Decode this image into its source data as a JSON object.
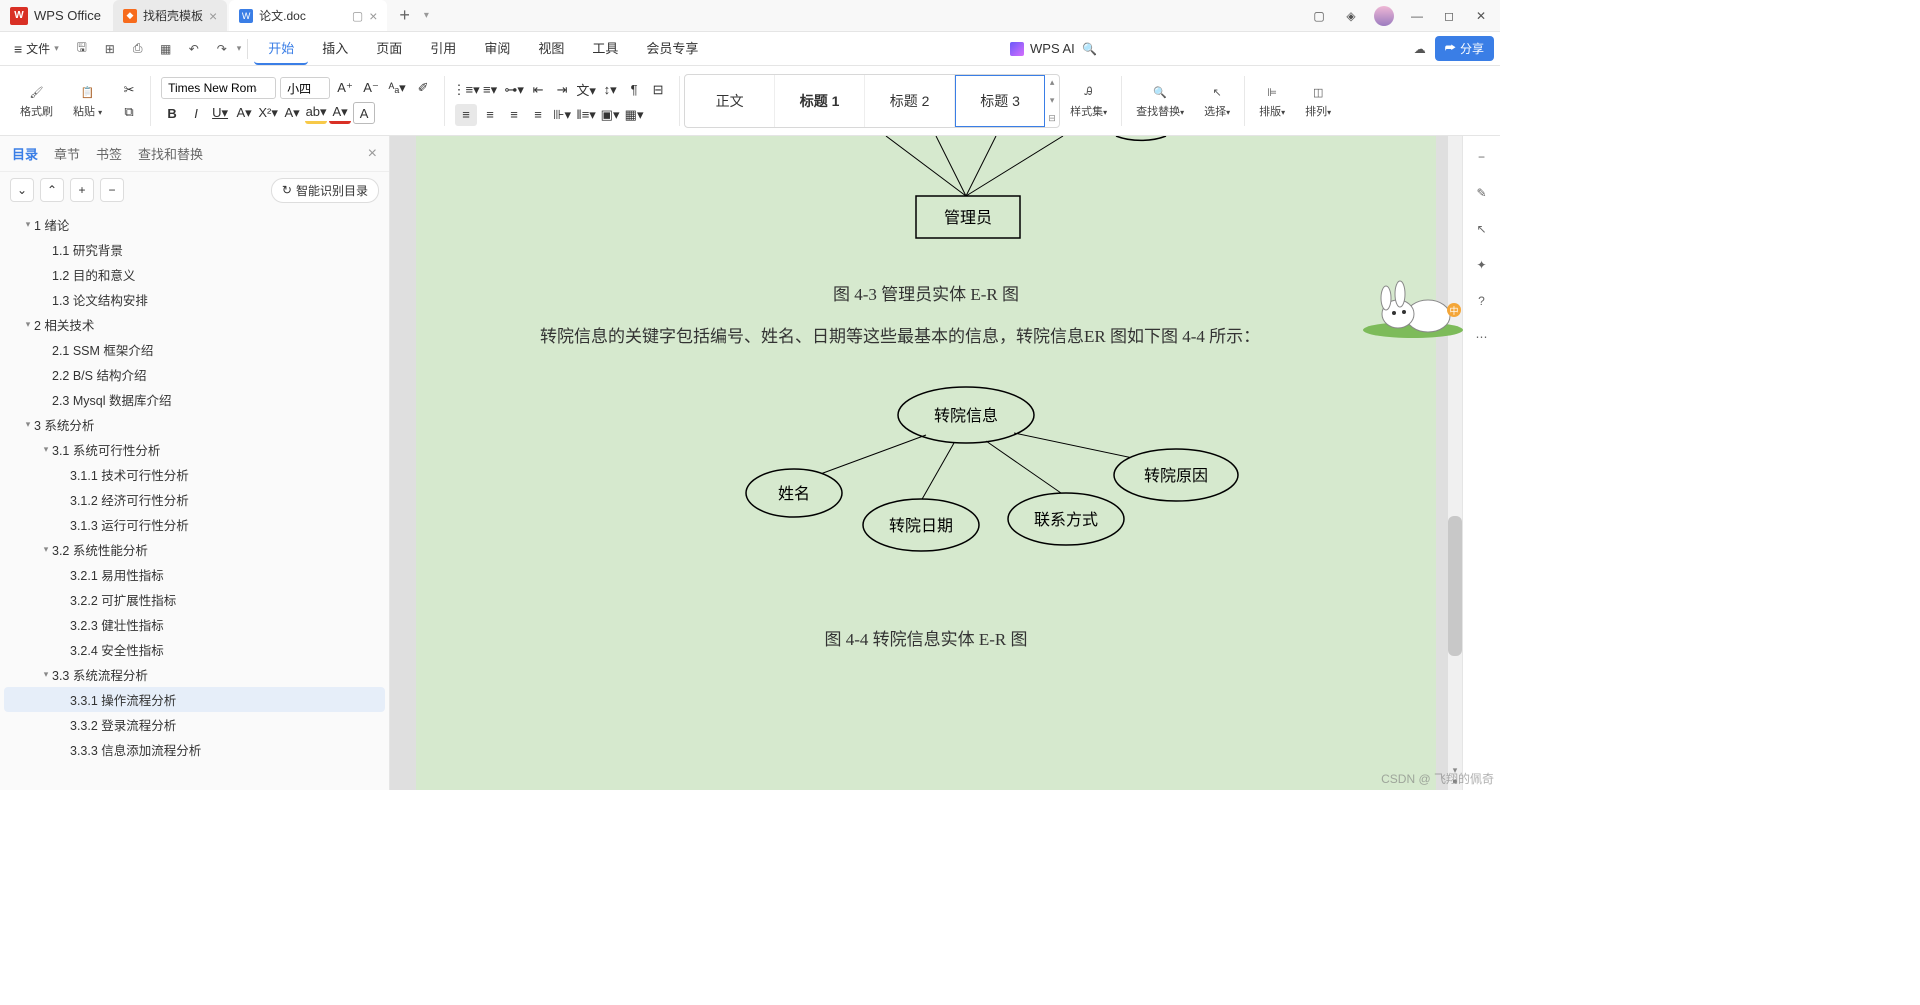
{
  "app": {
    "name": "WPS Office"
  },
  "tabs": [
    {
      "label": "找稻壳模板",
      "icon_color": "orange"
    },
    {
      "label": "论文.doc",
      "icon_color": "blue",
      "active": true
    }
  ],
  "menu": {
    "file": "文件",
    "items": [
      "开始",
      "插入",
      "页面",
      "引用",
      "审阅",
      "视图",
      "工具",
      "会员专享"
    ],
    "active": "开始",
    "ai_label": "WPS AI",
    "share": "分享"
  },
  "ribbon": {
    "format_brush": "格式刷",
    "paste": "粘贴",
    "font_name": "Times New Roman",
    "font_size": "小四",
    "body_text": "正文",
    "heading1": "标题 1",
    "heading2": "标题 2",
    "heading3": "标题 3",
    "styles_set": "样式集",
    "find_replace": "查找替换",
    "select": "选择",
    "arrange": "排版",
    "arrange2": "排列"
  },
  "sidebar": {
    "tabs": [
      "目录",
      "章节",
      "书签",
      "查找和替换"
    ],
    "active": "目录",
    "smart": "智能识别目录",
    "outline": [
      {
        "level": 0,
        "text": "1 绪论",
        "caret": true
      },
      {
        "level": 1,
        "text": "1.1 研究背景"
      },
      {
        "level": 1,
        "text": "1.2 目的和意义"
      },
      {
        "level": 1,
        "text": "1.3 论文结构安排"
      },
      {
        "level": 0,
        "text": "2 相关技术",
        "caret": true
      },
      {
        "level": 1,
        "text": "2.1 SSM 框架介绍"
      },
      {
        "level": 1,
        "text": "2.2 B/S 结构介绍"
      },
      {
        "level": 1,
        "text": "2.3 Mysql 数据库介绍"
      },
      {
        "level": 0,
        "text": "3 系统分析",
        "caret": true
      },
      {
        "level": 1,
        "text": "3.1 系统可行性分析",
        "caret": true
      },
      {
        "level": 2,
        "text": "3.1.1 技术可行性分析"
      },
      {
        "level": 2,
        "text": "3.1.2 经济可行性分析"
      },
      {
        "level": 2,
        "text": "3.1.3 运行可行性分析"
      },
      {
        "level": 1,
        "text": "3.2 系统性能分析",
        "caret": true
      },
      {
        "level": 2,
        "text": "3.2.1 易用性指标"
      },
      {
        "level": 2,
        "text": "3.2.2 可扩展性指标"
      },
      {
        "level": 2,
        "text": "3.2.3 健壮性指标"
      },
      {
        "level": 2,
        "text": "3.2.4 安全性指标"
      },
      {
        "level": 1,
        "text": "3.3 系统流程分析",
        "caret": true
      },
      {
        "level": 2,
        "text": "3.3.1 操作流程分析",
        "selected": true
      },
      {
        "level": 2,
        "text": "3.3.2 登录流程分析"
      },
      {
        "level": 2,
        "text": "3.3.3 信息添加流程分析"
      }
    ]
  },
  "document": {
    "diagram1_admin": "管理员",
    "caption1": "图 4-3  管理员实体 E-R 图",
    "paragraph": "转院信息的关键字包括编号、姓名、日期等这些最基本的信息，转院信息ER 图如下图 4-4 所示：",
    "diagram2": {
      "center": "转院信息",
      "nodes": [
        "姓名",
        "转院日期",
        "联系方式",
        "转院原因"
      ]
    },
    "caption2": "图 4-4  转院信息实体 E-R 图"
  },
  "watermark": "CSDN @ 飞翔的佩奇"
}
